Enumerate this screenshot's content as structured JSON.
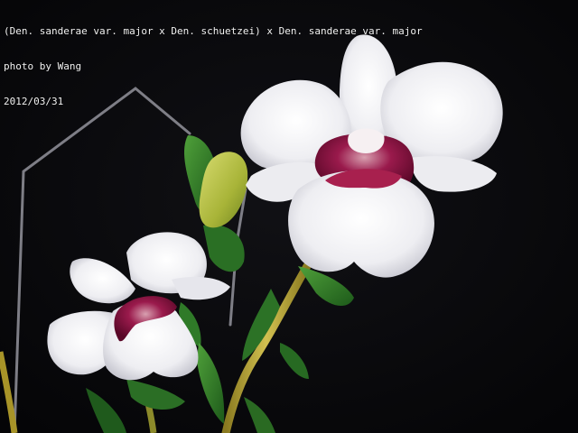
{
  "caption": {
    "title_line": "(Den. sanderae var. major x Den. schuetzei) x Den. sanderae var. major",
    "credit_line": "photo by Wang",
    "date_line": "2012/03/31"
  },
  "colors": {
    "background": "#08080a",
    "petal": "#f4f4f6",
    "lip_throat": "#8a1040",
    "leaf": "#2f7a28",
    "stem": "#b8a030",
    "bud": "#b6c040",
    "wire": "#8a8a90"
  },
  "subject": {
    "main_flower": "white-orchid-flower",
    "secondary_flower": "white-orchid-flower",
    "bud": "flower-bud",
    "support": "wire-stake"
  }
}
